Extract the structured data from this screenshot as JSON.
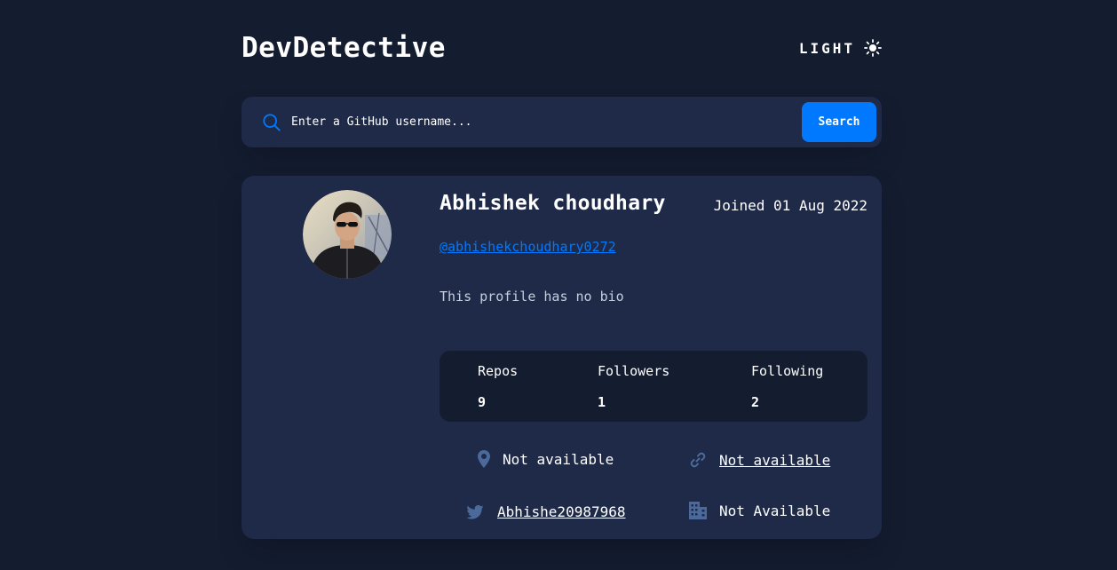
{
  "header": {
    "logo": "DevDetective",
    "theme_toggle_label": "LIGHT"
  },
  "search": {
    "placeholder": "Enter a GitHub username...",
    "button_label": "Search"
  },
  "profile": {
    "name": "Abhishek choudhary",
    "joined": "Joined 01 Aug 2022",
    "login": "@abhishekchoudhary0272",
    "bio": "This profile has no bio",
    "stats": [
      {
        "label": "Repos",
        "value": "9"
      },
      {
        "label": "Followers",
        "value": "1"
      },
      {
        "label": "Following",
        "value": "2"
      }
    ],
    "meta": {
      "location": {
        "icon": "map-pin-icon",
        "text": "Not available"
      },
      "website": {
        "icon": "link-icon",
        "text": "Not available"
      },
      "twitter": {
        "icon": "twitter-icon",
        "text": "Abhishe20987968"
      },
      "company": {
        "icon": "building-icon",
        "text": "Not Available"
      }
    }
  },
  "colors": {
    "background": "#141c2f",
    "card": "#1e2a47",
    "accent": "#0079ff",
    "icon": "#4b6a9b",
    "muted_text": "#c5cfe0"
  }
}
